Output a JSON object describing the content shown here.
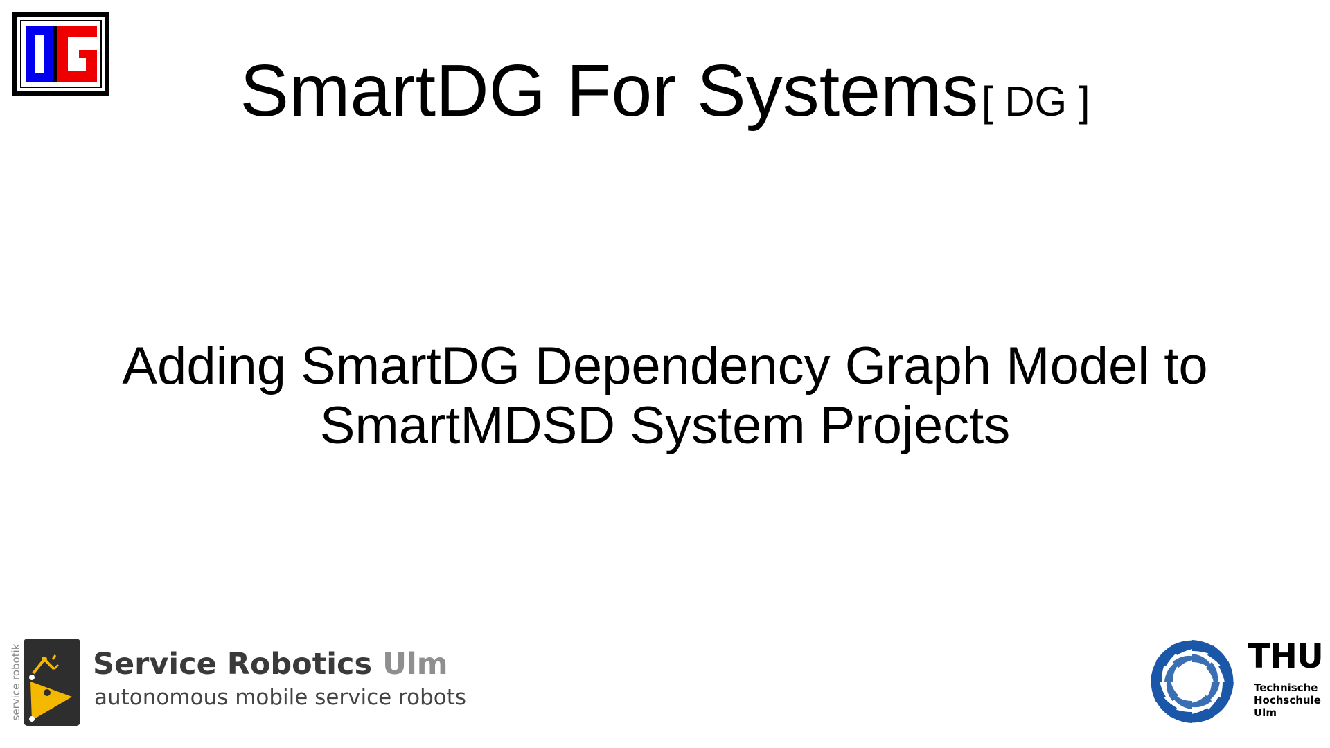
{
  "title": {
    "main": "SmartDG For Systems",
    "tag": "[ DG ]"
  },
  "subtitle": {
    "line1": "Adding SmartDG Dependency Graph Model to",
    "line2": "SmartMDSD System Projects"
  },
  "logos": {
    "dg": {
      "icon": "dg-logo-icon",
      "colors": {
        "blue": "#0000ee",
        "red": "#ee0000",
        "frame": "#000000"
      }
    },
    "service_robotics": {
      "vertical_text": "service robotik",
      "name": "Service Robotics",
      "name_suffix": "Ulm",
      "tagline": "autonomous mobile service robots",
      "colors": {
        "icon_bg": "#2e2e2e",
        "icon_accent": "#f5b800",
        "name": "#3a3a3a",
        "suffix": "#8f8f8f"
      }
    },
    "thu": {
      "abbr": "THU",
      "line1": "Technische",
      "line2": "Hochschule",
      "line3": "Ulm",
      "colors": {
        "swirl": "#1a57a8"
      }
    }
  }
}
